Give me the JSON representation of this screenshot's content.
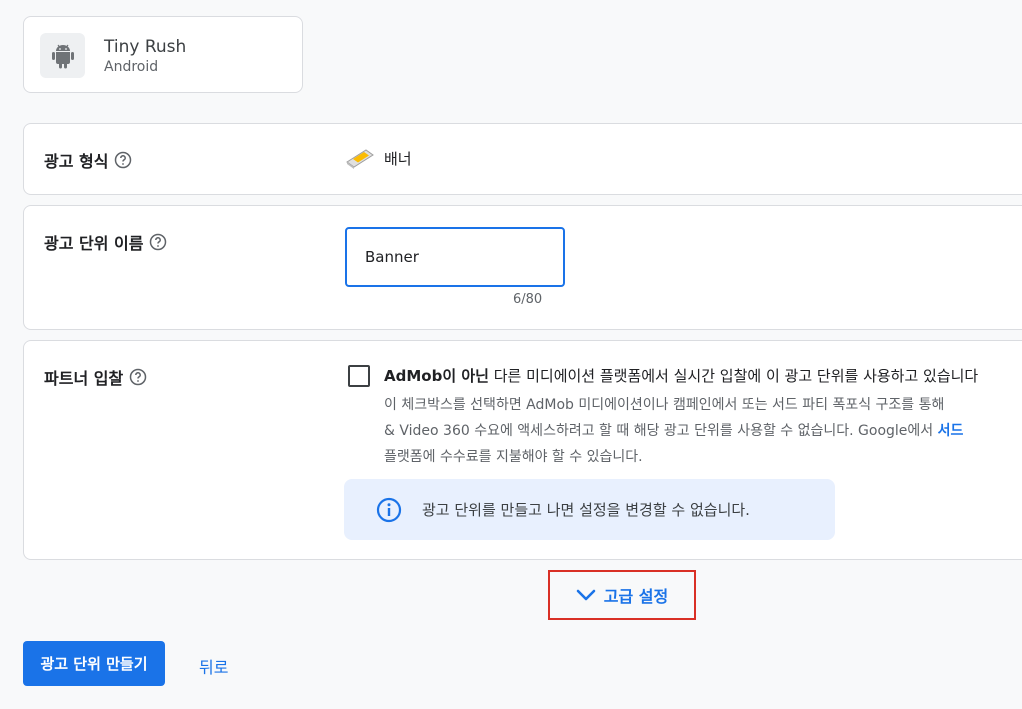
{
  "app": {
    "name": "Tiny Rush",
    "platform": "Android",
    "icon": "android-icon"
  },
  "ad_format": {
    "label": "광고 형식",
    "value": "배너",
    "icon": "banner-icon"
  },
  "ad_unit_name": {
    "label": "광고 단위 이름",
    "value": "Banner",
    "char_count": "6/80"
  },
  "partner_bidding": {
    "label": "파트너 입찰",
    "checked": false,
    "title_bold": "AdMob이 아닌",
    "title_rest": " 다른 미디에이션 플랫폼에서 실시간 입찰에 이 광고 단위를 사용하고 있습니다",
    "desc_line1": "이 체크박스를 선택하면 AdMob 미디에이션이나 캠페인에서 또는 서드 파티 폭포식 구조를 통해",
    "desc_line2": "& Video 360 수요에 액세스하려고 할 때 해당 광고 단위를 사용할 수 없습니다. Google에서 ",
    "desc_link": "서드",
    "desc_line3": "플랫폼에 수수료를 지불해야 할 수 있습니다.",
    "info": "광고 단위를 만들고 나면 설정을 변경할 수 없습니다."
  },
  "advanced": {
    "label": "고급 설정"
  },
  "actions": {
    "create_label": "광고 단위 만들기",
    "back_label": "뒤로"
  },
  "colors": {
    "accent": "#1a73e8",
    "highlight": "#d93025",
    "info_bg": "#e8f0fe"
  }
}
